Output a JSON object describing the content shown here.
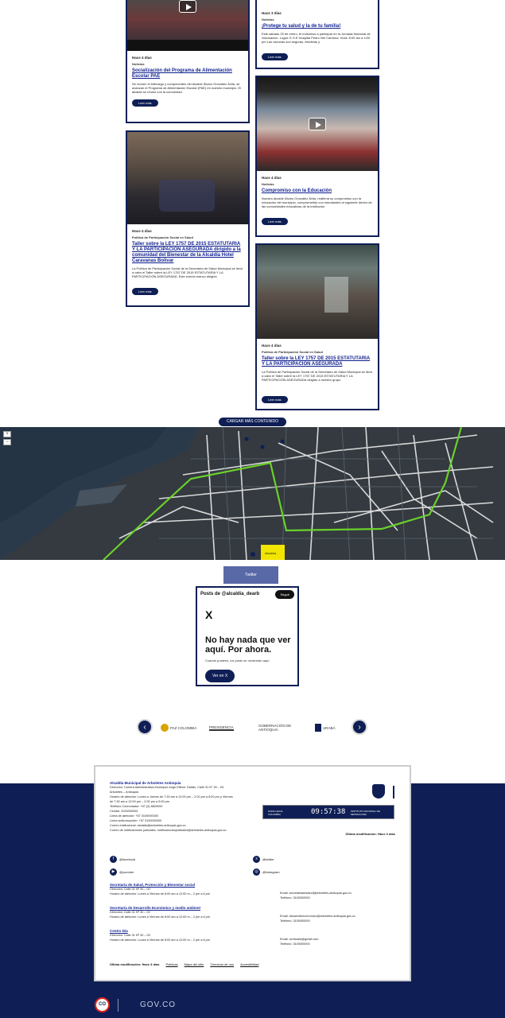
{
  "cards": [
    {
      "meta": "Hace 4 días",
      "category": "Noticias",
      "title": "Socialización del Programa de Alimentación Escolar PAE",
      "desc": "Se reúnen el liderazgo y componentes del Alcalde Álvaro González Ávila, se avanzan el Programa de Alimentación Escolar (PAE) en nuestro municipio. El alcalde se reunió con la comunidad",
      "btn": "Leer más"
    },
    {
      "meta": "Hace 4 días",
      "category": "Política de Participación Social en Salud",
      "title": "Taller sobre la LEY 1757 DE 2015 ESTATUTARIA Y LA PARTICIPACIÓN ASEGURADA dirigido a la comunidad del Bienestar de la Alcaldía Hotel Caravanas Bolívar",
      "desc": "La Política de Participación Social de la Secretaría de Salud Municipal se llevó a cabo el Taller sobre la LEY 1757 DE 2015 ESTATUTARIA Y LA PARTICIPACIÓN ASEGURADA. Este evento estuvo dirigido",
      "btn": "Leer más"
    },
    {
      "meta": "Hace 3 días",
      "category": "Noticias",
      "title": "¡Protege tu salud y la de tu familia!",
      "desc": "Este sábado 25 de enero, te invitamos a participar en la Jornada Nacional de Vacunación. Lugar: E.S.E Hospital Pedro Nel Cardona. Hora: 8:00 am a 4:00 pm Las vacunas son seguras, efectivas y",
      "btn": "Leer más"
    },
    {
      "meta": "Hace 4 días",
      "category": "Noticias",
      "title": "Compromiso con la Educación",
      "desc": "Nuestro alcalde Álvaro González Ávila, reafirma su compromiso con la educación del municipio, comprometido con estudiantes al siguiente dentro de las comunidades educativas de la Institución",
      "btn": "Leer más"
    },
    {
      "meta": "Hace 4 días",
      "category": "Política de Participación Social en Salud",
      "title": "Taller sobre la LEY 1757 DE 2015 ESTATUTARIA Y LA PARTICIPACIÓN ASEGURADA",
      "desc": "La Política de Participación Social de la Secretaría de Salud Municipal se llevó a cabo el Taller sobre la LEY 1757 DE 2015 ESTATUTARIA Y LA PARTICIPACIÓN ASEGURADA dirigido a nuestro grupo",
      "btn": "Leer más"
    }
  ],
  "load_more": "CARGAR MÁS CONTENIDO",
  "map": {
    "zoom_in": "+",
    "zoom_out": "−",
    "label": "Alcaldía"
  },
  "twitter": {
    "tab": "Twitter",
    "header": "Posts de @alcaldia_dearb",
    "follow": "Seguir",
    "x_logo": "X",
    "empty_title": "No hay nada que ver aquí. Por ahora.",
    "empty_sub": "Cuando postees, los posts se mostrarán aquí.",
    "view_btn": "Ver en X"
  },
  "carousel": {
    "prev": "‹",
    "next": "›",
    "logos": [
      "PAZ COLOMBIA",
      "PRESIDENCIA",
      "GOBERNACIÓN DE ANTIOQUIA",
      "URABÁ"
    ]
  },
  "footer": {
    "entity": "Alcaldía Municipal de Arboletes Antioquia",
    "lines": [
      "Dirección: Carrera Administrativa Municipal Jorge Eliécer Gaitán, Calle 31 N° 30 – 00,",
      "Arboletes – Antioquia",
      "Horario de atención: Lunes a Jueves de 7:30 am a 12:00 pm – 2:00 pm a 6:00 pm y Viernes",
      "de 7:30 am a 12:00 pm – 2:00 pm a 5:00 pm",
      "Teléfono Conmutador: +57 (4) 8820000",
      "Celular: 3100000000",
      "Línea de atención: +57 3100000000",
      "Línea anticorrupción: +57 3100000000",
      "Correo institucional: alcaldia@arboletes-antioquia.gov.co",
      "Correo de notificaciones judiciales: notificacionesjudiciales@arboletes-antioquia.gov.co"
    ],
    "clock": "09:57:38",
    "clock_left": "HORA LEGAL COLOMBIA",
    "clock_right": "INSTITUTO NACIONAL DE METROLOGÍA",
    "last_mod": "Última modificación: Hace 3 días",
    "socials": [
      "@facebook",
      "@twitter",
      "@youtube",
      "@instagram"
    ],
    "sections": [
      {
        "title": "Secretaría de Salud, Protección y Bienestar social",
        "l1": "Dirección: Calle 31 Nº 30 – 00",
        "l2": "Horario de atención: Lunes a Viernes de 8:00 am a 12:00 m – 2 pm a 6 pm",
        "email": "Email: secretariadesalud@arboletes-antioquia.gov.co",
        "tel": "Teléfono: 3100000000"
      },
      {
        "title": "Secretaría de Desarrollo Económico y medio ambient",
        "l1": "Dirección: Calle 31 Nº 30 – 00",
        "l2": "Horario de atención: Lunes a Viernes de 8:00 am a 12:00 m – 2 pm a 6 pm",
        "email": "Email: desarrolloeconomico@arboletes-antioquia.gov.co",
        "tel": "Teléfono: 3100000000"
      },
      {
        "title": "Centro Día",
        "l1": "Dirección: Calle 31 Nº 30 – 00",
        "l2": "Horario de atención: Lunes a Viernes de 8:00 am a 12:00 m – 2 pm a 6 pm",
        "email": "Email: centrodia@gmail.com",
        "tel": "Teléfono: 3100000000"
      }
    ],
    "bottom_links": [
      "Última modificación: Hace 3 días",
      "Políticas",
      "Mapa del sitio",
      "Términos de uso",
      "Accesibilidad"
    ]
  },
  "govco": {
    "badge": "CO",
    "label": "GOV.CO"
  }
}
